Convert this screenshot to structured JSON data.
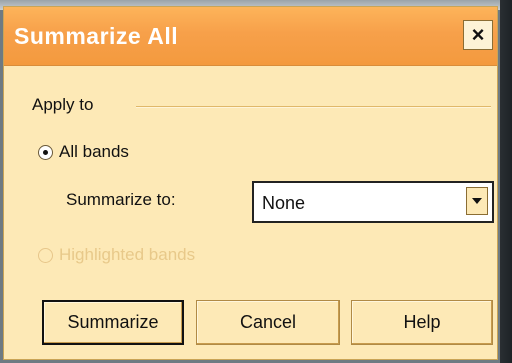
{
  "dialog": {
    "title": "Summarize All",
    "close_label": "×"
  },
  "apply_to": {
    "group_label": "Apply to",
    "all_bands": {
      "label": "All bands",
      "checked": true
    },
    "summarize_to": {
      "label": "Summarize to:",
      "selected": "None"
    },
    "highlighted_bands": {
      "label": "Highlighted bands",
      "checked": false,
      "disabled": true
    }
  },
  "buttons": {
    "summarize": "Summarize",
    "cancel": "Cancel",
    "help": "Help"
  },
  "colors": {
    "title_bar": "#f7a04a",
    "dialog_bg": "#fde9b6",
    "disabled_text": "#e8c98a"
  }
}
